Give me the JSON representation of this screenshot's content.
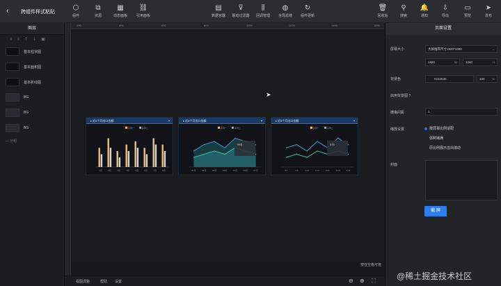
{
  "app": {
    "title": "跨组件样式粘贴"
  },
  "toolbar_left": [
    {
      "label": "组件",
      "icon": "cube-icon"
    },
    {
      "label": "资源",
      "icon": "layers-icon"
    },
    {
      "label": "动态面板",
      "icon": "grid-icon"
    },
    {
      "label": "引用面板",
      "icon": "link-icon"
    }
  ],
  "toolbar_center": [
    {
      "label": "数据容器",
      "icon": "database-icon"
    },
    {
      "label": "联动过滤器",
      "icon": "filter-icon"
    },
    {
      "label": "回调管理",
      "icon": "sliders-icon"
    },
    {
      "label": "全局滤镜",
      "icon": "palette-icon"
    },
    {
      "label": "组件更新",
      "icon": "refresh-icon"
    }
  ],
  "toolbar_right": [
    {
      "label": "回收站",
      "icon": "trash-icon"
    },
    {
      "label": "搜索",
      "icon": "search-icon"
    },
    {
      "label": "通知",
      "icon": "bell-icon"
    },
    {
      "label": "导出",
      "icon": "export-icon"
    },
    {
      "label": "预览",
      "icon": "preview-icon"
    },
    {
      "label": "发布",
      "icon": "send-icon"
    }
  ],
  "layers": {
    "title": "图层",
    "items": [
      {
        "label": "基本柱状图",
        "thumb": "bar"
      },
      {
        "label": "基本面积图",
        "thumb": "area"
      },
      {
        "label": "基本折线图",
        "thumb": "line"
      },
      {
        "label": "BG",
        "thumb": "bg"
      },
      {
        "label": "BG",
        "thumb": "bg"
      },
      {
        "label": "BG",
        "thumb": "bg"
      }
    ],
    "footer": "分组"
  },
  "ruler": [
    "200",
    "400",
    "600",
    "800",
    "1000",
    "1200",
    "1400",
    "1600",
    "1800"
  ],
  "canvas": {
    "hint": "按住空格可拖"
  },
  "bottombar": {
    "items": [
      "视图调整",
      "帮助",
      "设置"
    ],
    "zoom_icons": [
      "zoom-out-icon",
      "zoom-in-icon",
      "fit-screen-icon"
    ]
  },
  "charts": [
    {
      "title": "近6个月出口金额",
      "legend": [
        "系列一",
        "系列二"
      ]
    },
    {
      "title": "近6个月出口金额",
      "legend": [
        "系列一",
        "系列二"
      ],
      "tooltip": "06月"
    },
    {
      "title": "近6个月出口金额",
      "legend": [
        "系列一",
        "系列二"
      ],
      "tooltip": "3-31"
    }
  ],
  "chart_data": [
    {
      "type": "bar",
      "categories": [
        "1月",
        "2月",
        "3月",
        "4月",
        "5月",
        "6月",
        "7月",
        "8月"
      ],
      "series": [
        {
          "name": "系列一",
          "values": [
            6,
            9,
            5,
            7,
            8,
            6,
            9,
            7
          ]
        },
        {
          "name": "系列二",
          "values": [
            4,
            6,
            3,
            5,
            6,
            4,
            7,
            5
          ]
        }
      ],
      "ylim": [
        0,
        10
      ]
    },
    {
      "type": "area",
      "categories": [
        "01月",
        "02月",
        "03月",
        "04月",
        "05月",
        "06月",
        "07月"
      ],
      "series": [
        {
          "name": "系列一",
          "values": [
            5,
            7,
            8,
            6,
            9,
            8,
            7
          ]
        },
        {
          "name": "系列二",
          "values": [
            3,
            4,
            5,
            4,
            6,
            5,
            4
          ]
        }
      ],
      "ylim": [
        0,
        10
      ]
    },
    {
      "type": "line",
      "categories": [
        "3-1",
        "3-6",
        "3-11",
        "3-16",
        "3-21",
        "3-26",
        "3-31"
      ],
      "series": [
        {
          "name": "系列一",
          "values": [
            6,
            7,
            5,
            8,
            6,
            9,
            7
          ]
        },
        {
          "name": "系列二",
          "values": [
            3,
            4,
            3,
            5,
            4,
            5,
            4
          ]
        }
      ],
      "ylim": [
        0,
        10
      ]
    }
  ],
  "settings": {
    "title": "页面设置",
    "screen_size_label": "屏幕大小",
    "screen_size_value": "大屏推荐尺寸1920*1080",
    "width": "1920",
    "width_unit": "W",
    "height": "1080",
    "height_unit": "H",
    "bg_label": "背景色",
    "bg_value": "#232630",
    "bg_opacity": "100",
    "bg_opacity_unit": "%",
    "bg_image_label": "启用背景图",
    "grid_label": "栅格间距",
    "grid_value": "1",
    "scale_label": "缩放设置",
    "scale_options": [
      "按屏幕比例适配",
      "强制铺满",
      "原比例展示溢出滚动"
    ],
    "cover_label": "封面",
    "save_label": "截 屏"
  },
  "watermark": "@稀土掘金技术社区"
}
